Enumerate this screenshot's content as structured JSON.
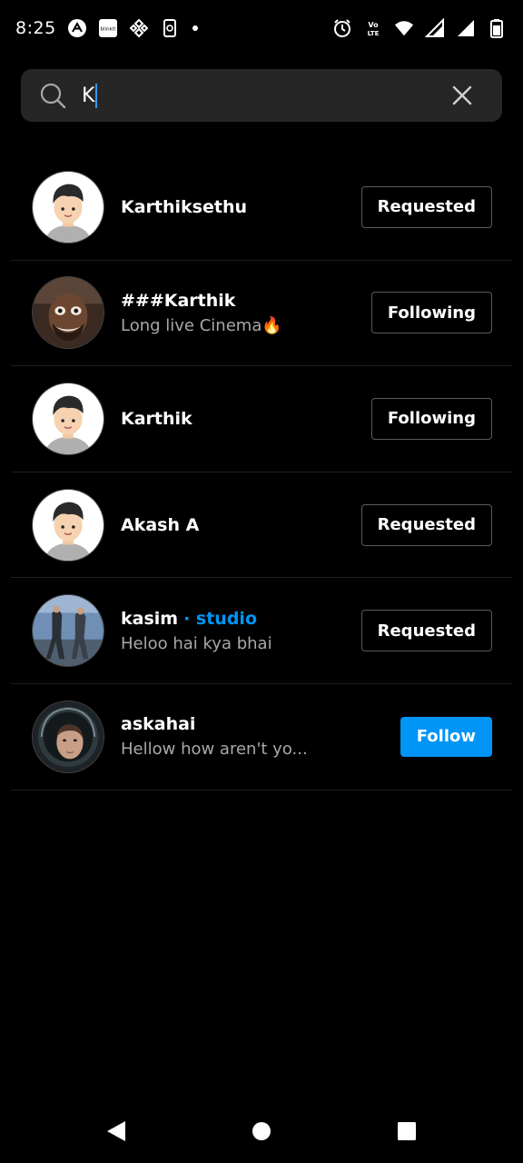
{
  "status_bar": {
    "time": "8:25",
    "left_icons": [
      "notification-app-icon",
      "blinkit-icon",
      "binance-icon",
      "phone-sync-icon"
    ],
    "right_icons": [
      "alarm-icon",
      "volte-icon",
      "wifi-icon",
      "signal-icon",
      "signal-icon-2",
      "battery-icon"
    ],
    "blinkit_label": "blinkit",
    "volte_label": "Vo LTE"
  },
  "search": {
    "value": "K",
    "placeholder": "Search",
    "accent": "#3897f0"
  },
  "results": [
    {
      "username": "Karthiksethu",
      "tag": "",
      "subtitle": "",
      "action": "Requested",
      "avatar": "cartoon"
    },
    {
      "username": "###Karthik",
      "tag": "",
      "subtitle": "Long live Cinema🔥",
      "action": "Following",
      "avatar": "photo-man"
    },
    {
      "username": "Karthik",
      "tag": "",
      "subtitle": "",
      "action": "Following",
      "avatar": "cartoon"
    },
    {
      "username": "Akash A",
      "tag": "",
      "subtitle": "",
      "action": "Requested",
      "avatar": "cartoon"
    },
    {
      "username": "kasim",
      "tag": "· studio",
      "subtitle": "Heloo hai kya bhai",
      "action": "Requested",
      "avatar": "photo-dancers"
    },
    {
      "username": "askahai",
      "tag": "",
      "subtitle": "Hellow how aren't yo...",
      "action": "Follow",
      "avatar": "photo-astronaut"
    }
  ],
  "colors": {
    "background": "#000000",
    "follow_button": "#0095f6",
    "tag": "#0095f6",
    "secondary_text": "#a8a8a8"
  },
  "nav": {
    "icons": [
      "back-icon",
      "home-icon",
      "recents-icon"
    ]
  }
}
